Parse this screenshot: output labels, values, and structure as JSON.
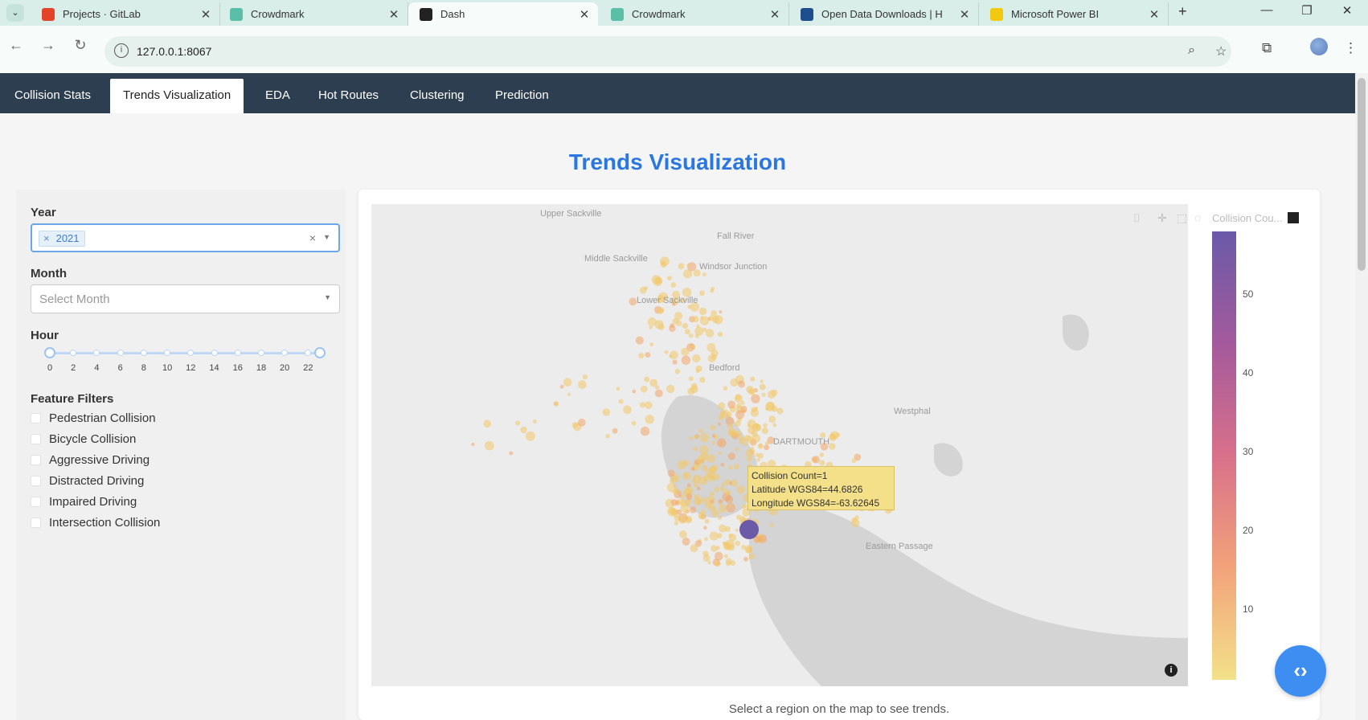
{
  "browser": {
    "tabs": [
      {
        "title": "Projects · GitLab",
        "favicon_color": "#e24329",
        "active": false
      },
      {
        "title": "Crowdmark",
        "favicon_color": "#5bbfa8",
        "active": false
      },
      {
        "title": "Dash",
        "favicon_color": "#222222",
        "active": true
      },
      {
        "title": "Crowdmark",
        "favicon_color": "#5bbfa8",
        "active": false
      },
      {
        "title": "Open Data Downloads | H",
        "favicon_color": "#1f4e8c",
        "active": false
      },
      {
        "title": "Microsoft Power BI",
        "favicon_color": "#f2c811",
        "active": false
      }
    ],
    "url": "127.0.0.1:8067",
    "tab_close_glyph": "✕",
    "new_tab_glyph": "+"
  },
  "nav": {
    "tabs": [
      {
        "label": "Collision Stats",
        "active": false
      },
      {
        "label": "Trends Visualization",
        "active": true
      },
      {
        "label": "EDA",
        "active": false
      },
      {
        "label": "Hot Routes",
        "active": false
      },
      {
        "label": "Clustering",
        "active": false
      },
      {
        "label": "Prediction",
        "active": false
      }
    ]
  },
  "page": {
    "title": "Trends Visualization",
    "caption": "Select a region on the map to see trends."
  },
  "filters": {
    "year_label": "Year",
    "year_selected": "2021",
    "month_label": "Month",
    "month_placeholder": "Select Month",
    "hour_label": "Hour",
    "hour_range": [
      0,
      23
    ],
    "hour_ticks": [
      "0",
      "2",
      "4",
      "6",
      "8",
      "10",
      "12",
      "14",
      "16",
      "18",
      "20",
      "22"
    ],
    "feature_label": "Feature Filters",
    "features": [
      "Pedestrian Collision",
      "Bicycle Collision",
      "Aggressive Driving",
      "Distracted Driving",
      "Impaired Driving",
      "Intersection Collision"
    ]
  },
  "map": {
    "place_labels": [
      "Upper Sackville",
      "Fall River",
      "Middle Sackville",
      "Windsor Junction",
      "Lower Sackville",
      "Bedford",
      "Westphal",
      "DARTMOUTH",
      "Eastern Passage"
    ],
    "colorbar_title": "Collision Cou...",
    "colorbar_ticks": [
      "50",
      "40",
      "30",
      "20",
      "10"
    ],
    "colorbar_range": [
      1,
      58
    ],
    "tooltip": {
      "line1": "Collision Count=1",
      "line2": "Latitude WGS84=44.6826",
      "line3": "Longitude WGS84=-63.62645"
    },
    "colors": {
      "high": "#6a5aa8",
      "mid": "#d8708a",
      "low": "#f3e18a",
      "water": "#d4d4d4",
      "land": "#ececec"
    }
  }
}
